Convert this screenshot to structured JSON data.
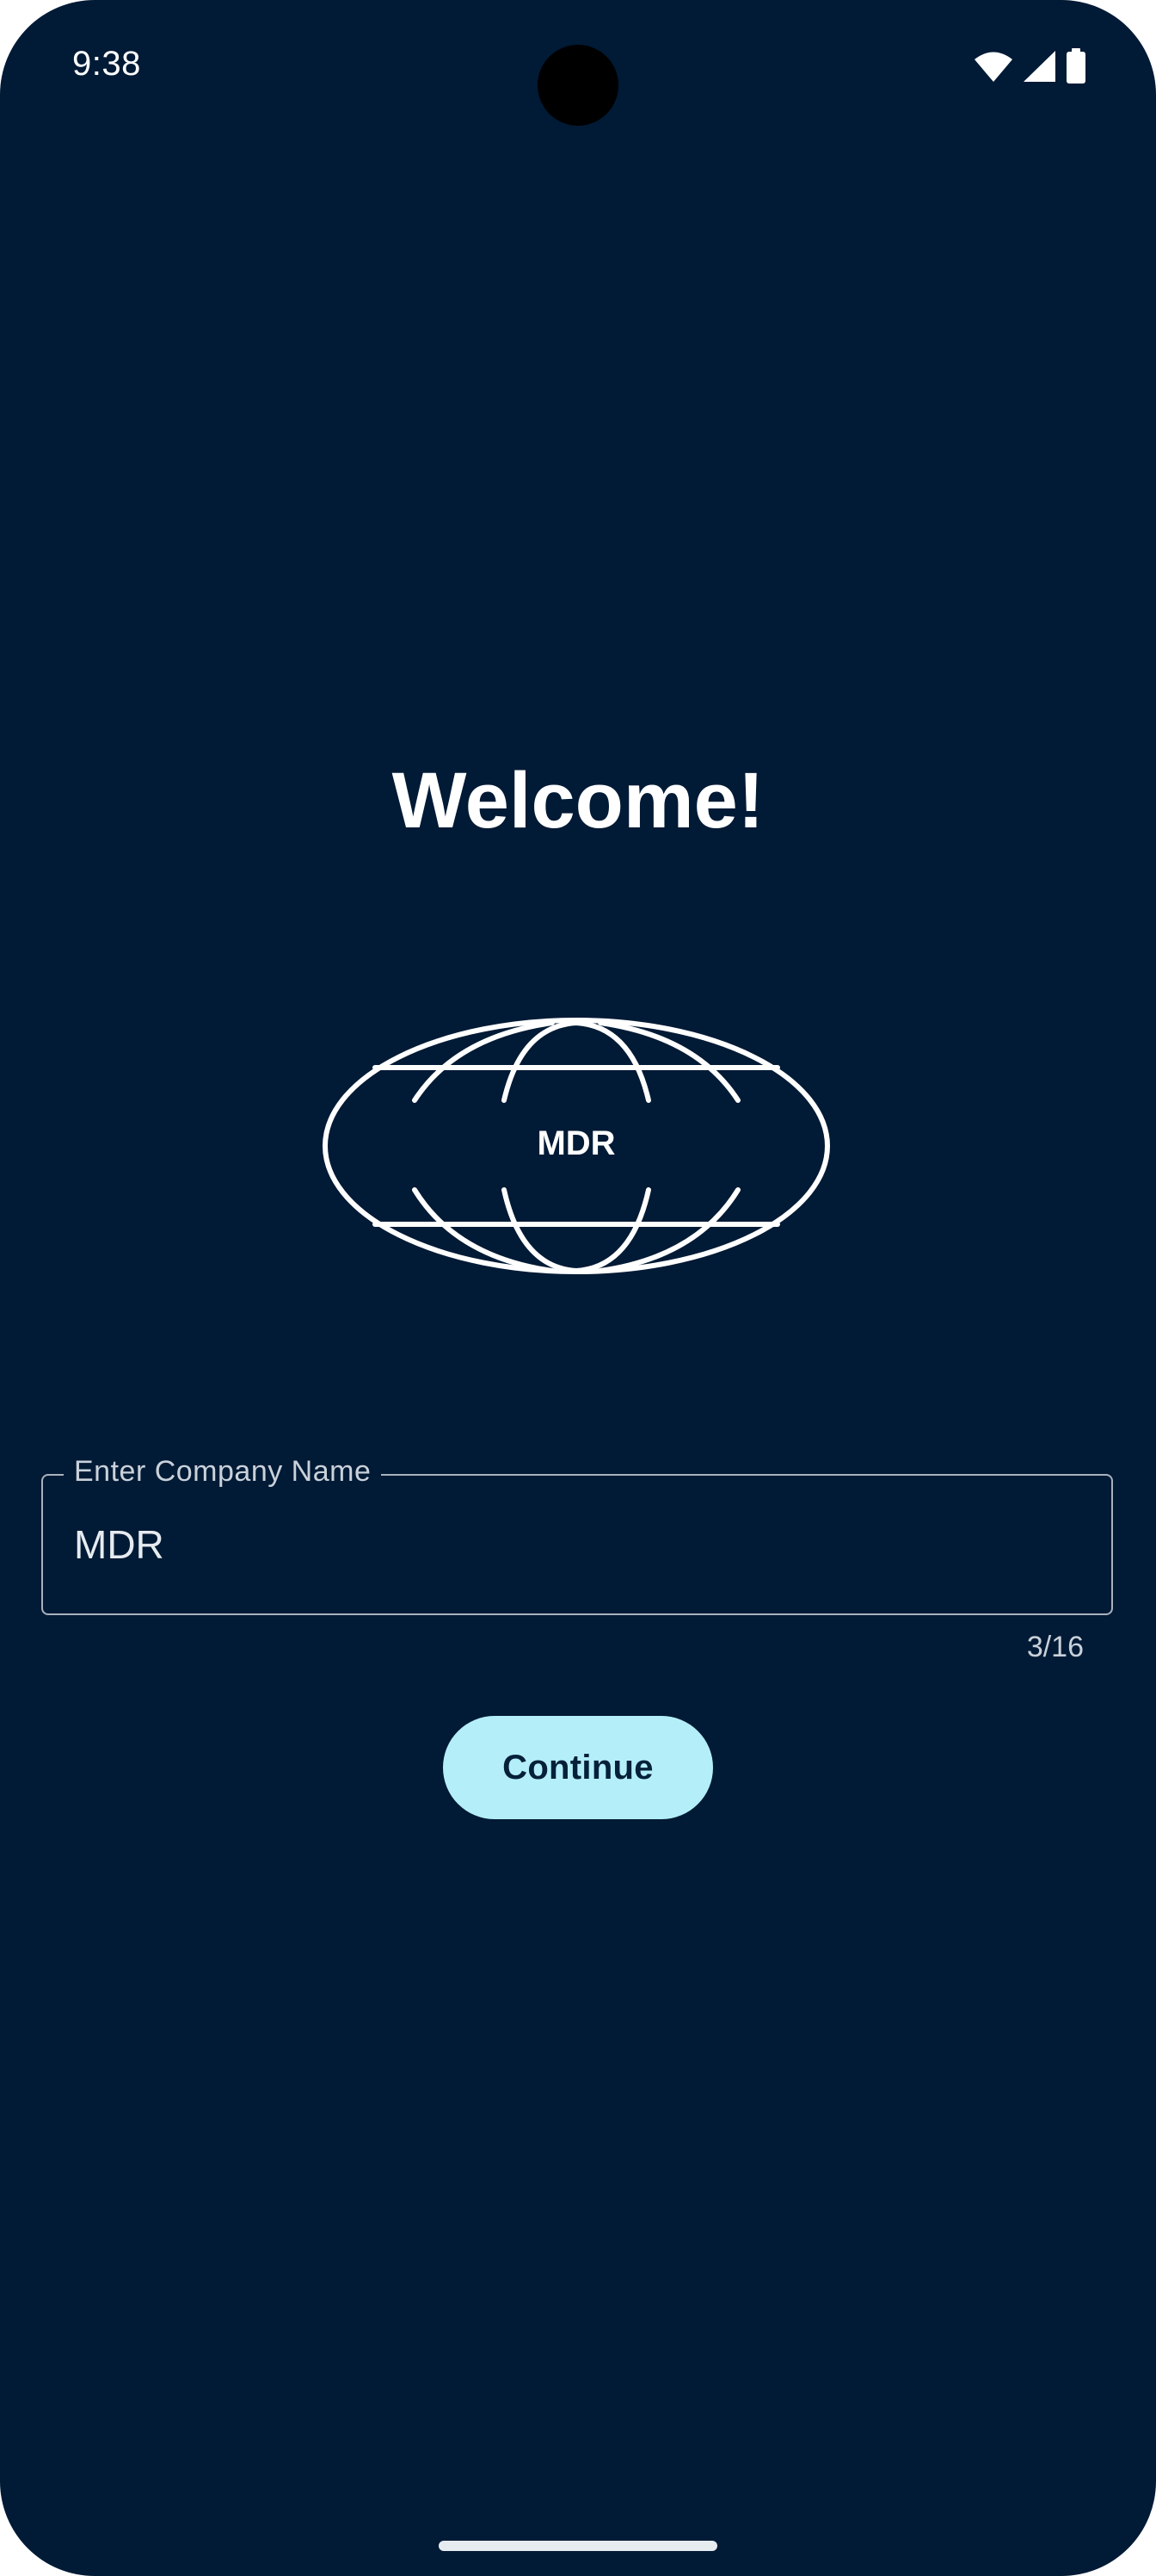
{
  "status_bar": {
    "time": "9:38",
    "icons": [
      "wifi-icon",
      "signal-icon",
      "battery-icon"
    ]
  },
  "welcome": {
    "title": "Welcome!"
  },
  "logo": {
    "text": "MDR",
    "icon": "globe-logo-icon"
  },
  "company_field": {
    "label": "Enter Company Name",
    "value": "MDR",
    "counter": "3/16"
  },
  "actions": {
    "continue_label": "Continue"
  },
  "colors": {
    "background": "#011a35",
    "button": "#b4eff9",
    "text": "#ffffff"
  }
}
